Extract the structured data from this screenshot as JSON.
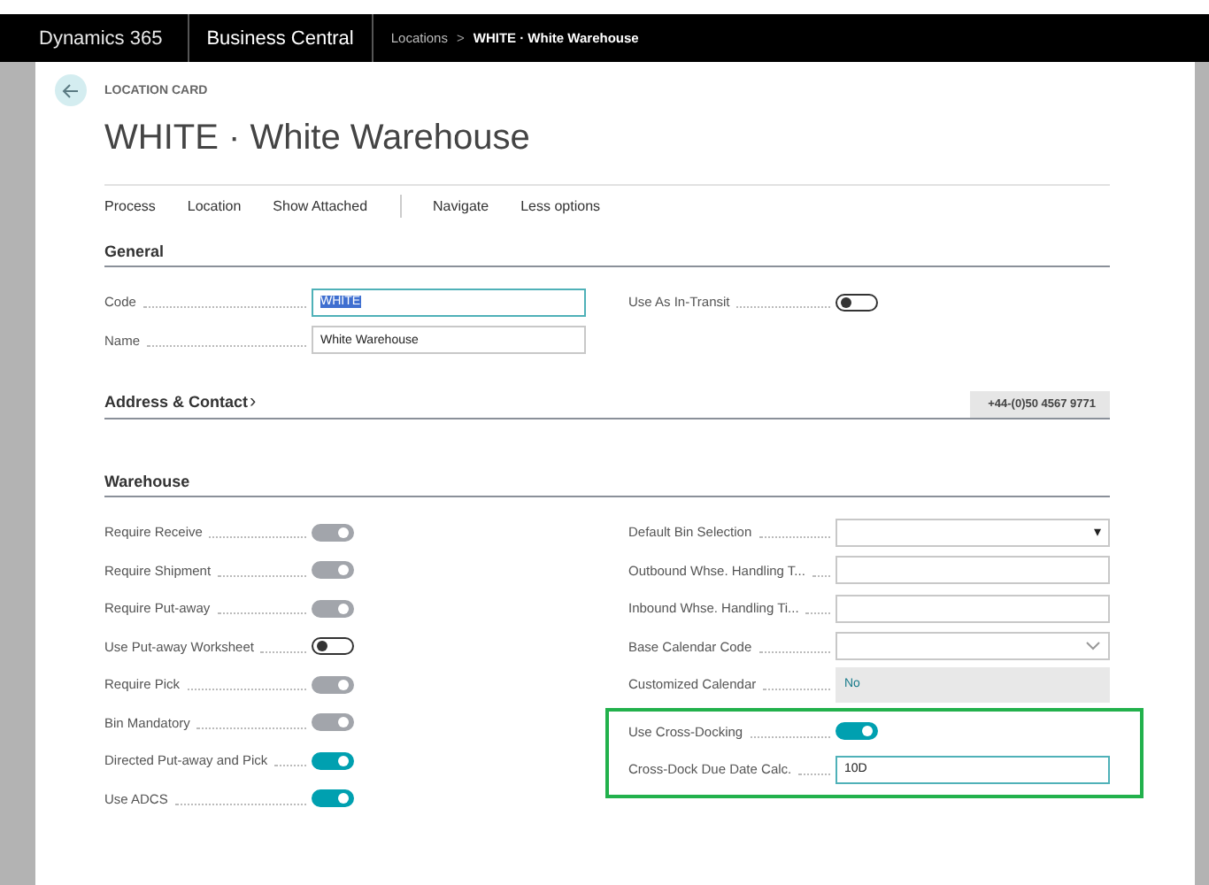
{
  "top_bar": {
    "product": "Dynamics 365",
    "app": "Business Central",
    "breadcrumb": [
      {
        "label": "Locations",
        "current": false
      },
      {
        "label": "WHITE · White Warehouse",
        "current": true
      }
    ],
    "separator": ">"
  },
  "page": {
    "caption": "LOCATION CARD",
    "title": "WHITE · White Warehouse"
  },
  "action_groups": [
    [
      "Process",
      "Location",
      "Show Attached"
    ],
    [
      "Navigate",
      "Less options"
    ]
  ],
  "general": {
    "title": "General",
    "left": [
      {
        "label": "Code",
        "kind": "text",
        "value": "WHITE",
        "focused": true,
        "text_selected": true
      },
      {
        "label": "Name",
        "kind": "text",
        "value": "White Warehouse",
        "focused": false,
        "text_selected": false
      }
    ],
    "right": [
      {
        "label": "Use As In-Transit",
        "kind": "toggle",
        "on": false,
        "disabled": false
      }
    ]
  },
  "address": {
    "title": "Address & Contact",
    "expand_icon": "›",
    "expanded": false,
    "phone": "+44-(0)50 4567 9771"
  },
  "warehouse": {
    "title": "Warehouse",
    "left": [
      {
        "label": "Require Receive",
        "kind": "toggle",
        "on": true,
        "disabled": true
      },
      {
        "label": "Require Shipment",
        "kind": "toggle",
        "on": true,
        "disabled": true
      },
      {
        "label": "Require Put-away",
        "kind": "toggle",
        "on": true,
        "disabled": true
      },
      {
        "label": "Use Put-away Worksheet",
        "kind": "toggle",
        "on": false,
        "disabled": false
      },
      {
        "label": "Require Pick",
        "kind": "toggle",
        "on": true,
        "disabled": true
      },
      {
        "label": "Bin Mandatory",
        "kind": "toggle",
        "on": true,
        "disabled": true
      },
      {
        "label": "Directed Put-away and Pick",
        "kind": "toggle",
        "on": true,
        "disabled": false
      },
      {
        "label": "Use ADCS",
        "kind": "toggle",
        "on": true,
        "disabled": false
      }
    ],
    "right": [
      {
        "label": "Default Bin Selection",
        "kind": "select",
        "icon": "▾"
      },
      {
        "label": "Outbound Whse. Handling T...",
        "kind": "text",
        "focused": false
      },
      {
        "label": "Inbound Whse. Handling Ti...",
        "kind": "text",
        "focused": false
      },
      {
        "label": "Base Calendar Code",
        "kind": "dropdown"
      },
      {
        "label": "Customized Calendar",
        "kind": "readonly",
        "value": "No"
      }
    ],
    "highlighted": [
      {
        "label": "Use Cross-Docking",
        "kind": "toggle",
        "on": true,
        "disabled": false
      },
      {
        "label": "Cross-Dock Due Date Calc.",
        "kind": "text",
        "value": "10D",
        "focused": true,
        "text_selected": false
      }
    ]
  }
}
